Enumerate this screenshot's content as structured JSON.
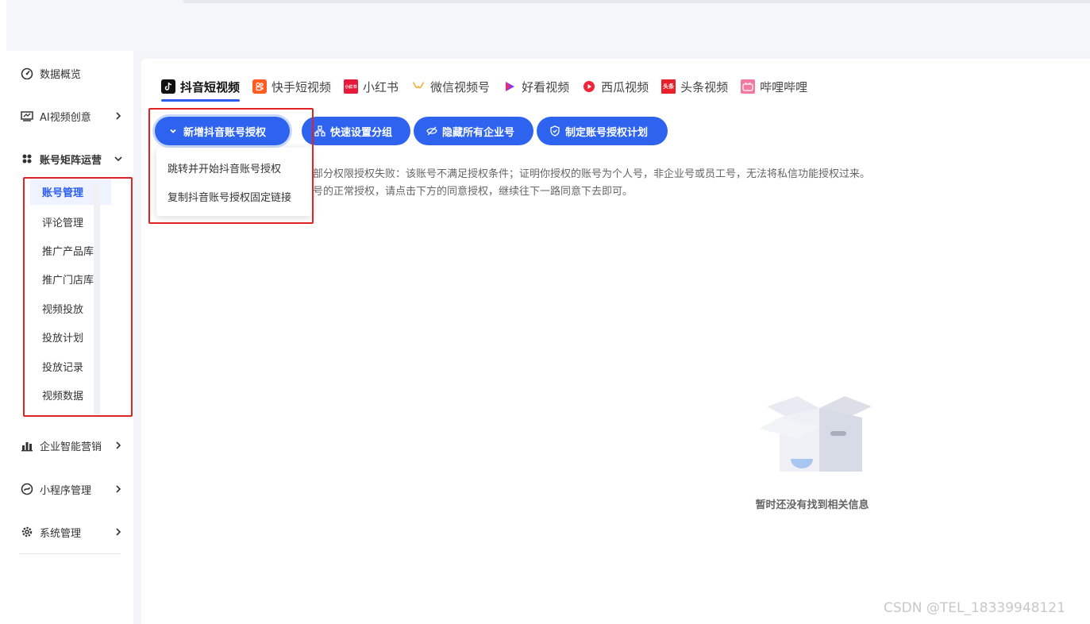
{
  "sidebar": {
    "items": [
      {
        "label": "数据概览",
        "icon": "dashboard-icon",
        "has_arrow": false
      },
      {
        "label": "AI视频创意",
        "icon": "video-creative-icon",
        "has_arrow": true
      },
      {
        "label": "账号矩阵运营",
        "icon": "matrix-icon",
        "has_arrow": true,
        "expanded": true
      },
      {
        "label": "企业智能营销",
        "icon": "bar-chart-icon",
        "has_arrow": true
      },
      {
        "label": "小程序管理",
        "icon": "mini-program-icon",
        "has_arrow": true
      },
      {
        "label": "系统管理",
        "icon": "gear-icon",
        "has_arrow": true
      }
    ],
    "sub_items": [
      {
        "label": "账号管理",
        "active": true
      },
      {
        "label": "评论管理"
      },
      {
        "label": "推广产品库"
      },
      {
        "label": "推广门店库"
      },
      {
        "label": "视频投放"
      },
      {
        "label": "投放计划"
      },
      {
        "label": "投放记录"
      },
      {
        "label": "视频数据"
      }
    ]
  },
  "tabs": [
    {
      "label": "抖音短视频",
      "icon": "douyin-icon",
      "active": true,
      "color": "#111111"
    },
    {
      "label": "快手短视频",
      "icon": "kuaishou-icon",
      "color": "#ff5a1f"
    },
    {
      "label": "小红书",
      "icon": "xiaohongshu-icon",
      "color": "#e6193b",
      "icon_text": "小红书"
    },
    {
      "label": "微信视频号",
      "icon": "wechat-channels-icon",
      "color": "#f5a623"
    },
    {
      "label": "好看视频",
      "icon": "haokan-icon",
      "color": "#7b3cf0"
    },
    {
      "label": "西瓜视频",
      "icon": "xigua-icon",
      "color": "#f0253a"
    },
    {
      "label": "头条视频",
      "icon": "toutiao-icon",
      "color": "#e8202a",
      "icon_text": "头条"
    },
    {
      "label": "哔哩哔哩",
      "icon": "bilibili-icon",
      "color": "#f27aa0"
    }
  ],
  "buttons": [
    {
      "label": "新增抖音账号授权",
      "icon": "chevron-down-icon"
    },
    {
      "label": "快速设置分组",
      "icon": "group-icon"
    },
    {
      "label": "隐藏所有企业号",
      "icon": "eye-off-icon"
    },
    {
      "label": "制定账号授权计划",
      "icon": "shield-icon"
    }
  ],
  "dropdown": [
    "跳转并开始抖音账号授权",
    "复制抖音账号授权固定链接"
  ],
  "notices": [
    "部分权限授权失败：该账号不满足授权条件；证明你授权的账号为个人号，非企业号或员工号，无法将私信功能授权过来。",
    "号的正常授权，请点击下方的同意授权，继续往下一路同意下去即可。"
  ],
  "empty_state": {
    "text": "暂时还没有找到相关信息",
    "icon": "empty-box-icon"
  },
  "watermark": "CSDN @TEL_18339948121",
  "colors": {
    "accent": "#2d63ef",
    "highlight": "#e02424"
  }
}
